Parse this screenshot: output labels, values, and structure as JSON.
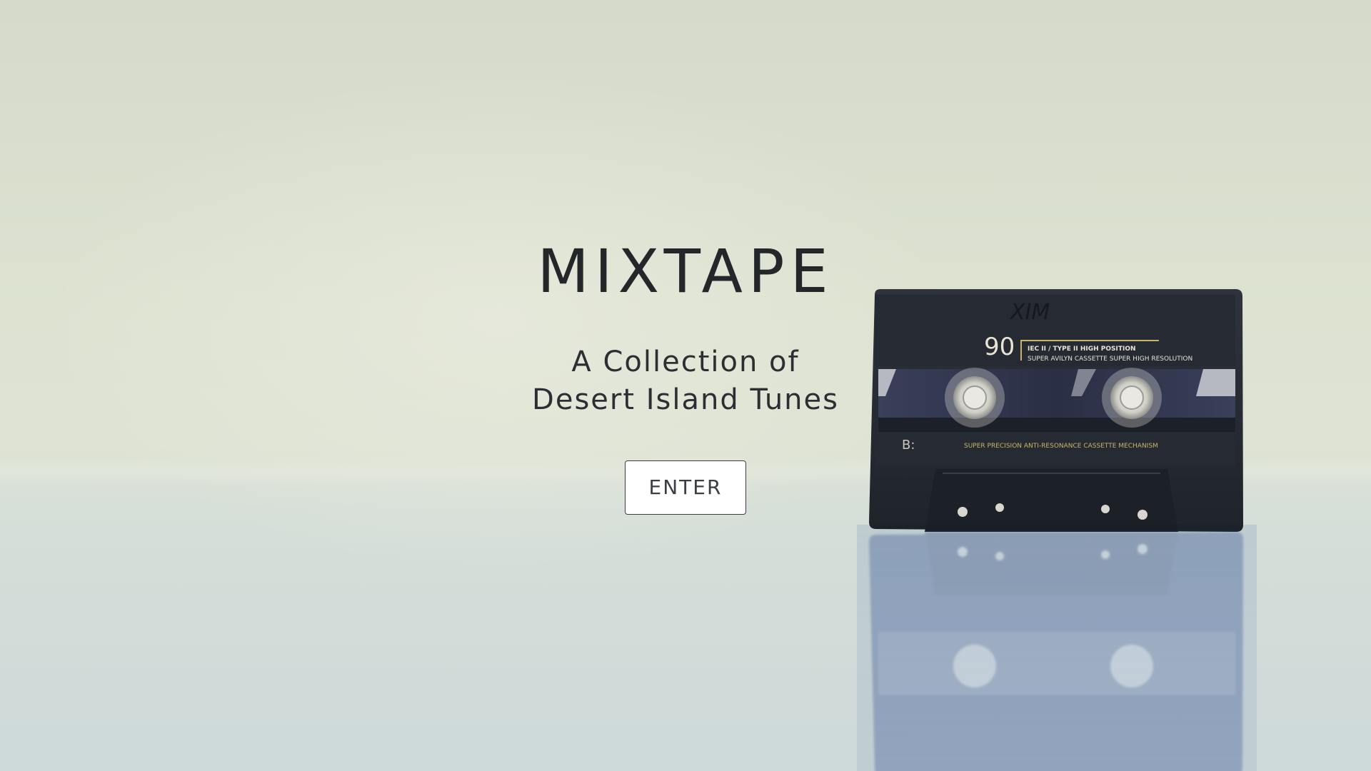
{
  "hero": {
    "title": "MIXTAPE",
    "subtitle_line1": "A Collection of",
    "subtitle_line2": "Desert Island Tunes",
    "enter_label": "ENTER"
  },
  "cassette": {
    "handwritten_label": "XIM",
    "length": "90",
    "spec_line1": "IEC II / TYPE II  HIGH POSITION",
    "spec_line2": "SUPER AVILYN CASSETTE SUPER HIGH RESOLUTION",
    "side": "B:",
    "mechanism": "SUPER PRECISION ANTI-RESONANCE CASSETTE MECHANISM"
  },
  "colors": {
    "background": "#dde2d1",
    "text": "#23272a",
    "button_bg": "#ffffff",
    "cassette_body": "#262b33",
    "cassette_gold": "#c9b46a"
  }
}
